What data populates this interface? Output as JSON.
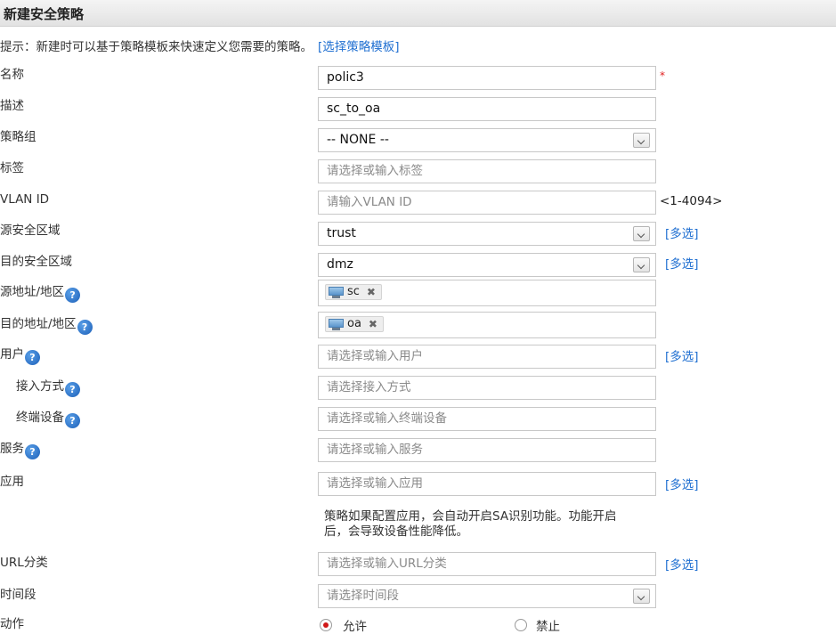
{
  "title": "新建安全策略",
  "hint": {
    "text": "提示：新建时可以基于策略模板来快速定义您需要的策略。",
    "link": "[选择策略模板]"
  },
  "help_glyph": "?",
  "fields": {
    "name": {
      "label": "名称",
      "value": "polic3",
      "required_mark": "*"
    },
    "description": {
      "label": "描述",
      "value": "sc_to_oa"
    },
    "policy_group": {
      "label": "策略组",
      "value": "-- NONE --"
    },
    "tag": {
      "label": "标签",
      "placeholder": "请选择或输入标签"
    },
    "vlan_id": {
      "label": "VLAN ID",
      "placeholder": "请输入VLAN ID",
      "range": "<1-4094>"
    },
    "src_zone": {
      "label": "源安全区域",
      "value": "trust",
      "multi": "[多选]"
    },
    "dst_zone": {
      "label": "目的安全区域",
      "value": "dmz",
      "multi": "[多选]"
    },
    "src_addr": {
      "label": "源地址/地区",
      "tag_value": "sc",
      "remove": "✖"
    },
    "dst_addr": {
      "label": "目的地址/地区",
      "tag_value": "oa",
      "remove": "✖"
    },
    "user": {
      "label": "用户",
      "placeholder": "请选择或输入用户",
      "multi": "[多选]"
    },
    "access_mode": {
      "label": "接入方式",
      "placeholder": "请选择接入方式"
    },
    "terminal": {
      "label": "终端设备",
      "placeholder": "请选择或输入终端设备"
    },
    "service": {
      "label": "服务",
      "placeholder": "请选择或输入服务"
    },
    "application": {
      "label": "应用",
      "placeholder": "请选择或输入应用",
      "multi": "[多选]",
      "note_line1": "策略如果配置应用，会自动开启SA识别功能。功能开启",
      "note_line2": "后，会导致设备性能降低。"
    },
    "url_category": {
      "label": "URL分类",
      "placeholder": "请选择或输入URL分类",
      "multi": "[多选]"
    },
    "time_range": {
      "label": "时间段",
      "placeholder": "请选择时间段"
    },
    "action": {
      "label": "动作",
      "options": [
        "允许",
        "禁止"
      ],
      "selected": "允许"
    }
  },
  "icons": {
    "help": "help-icon",
    "dropdown": "chevron-down-icon",
    "address": "monitor-icon",
    "remove": "close-icon"
  },
  "colors": {
    "link": "#1f6fd1",
    "required": "#e02020",
    "radio_selected": "#d01818"
  }
}
